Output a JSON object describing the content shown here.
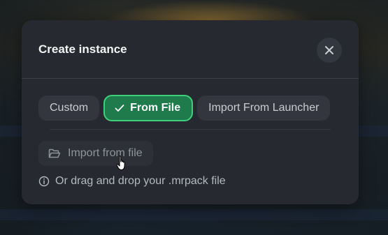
{
  "dialog": {
    "title": "Create instance",
    "close_icon": "close-icon"
  },
  "tabs": [
    {
      "label": "Custom",
      "active": false
    },
    {
      "label": "From File",
      "active": true,
      "icon": "check-icon"
    },
    {
      "label": "Import From Launcher",
      "active": false
    }
  ],
  "import_button": {
    "label": "Import from file",
    "icon": "folder-open-icon"
  },
  "hint": {
    "text": "Or drag and drop your .mrpack file",
    "icon": "info-icon"
  },
  "colors": {
    "modal_bg": "#26292f",
    "accent_bg": "#1f7a4c",
    "accent_border": "#3fd07d",
    "tab_bg": "#33363e"
  }
}
